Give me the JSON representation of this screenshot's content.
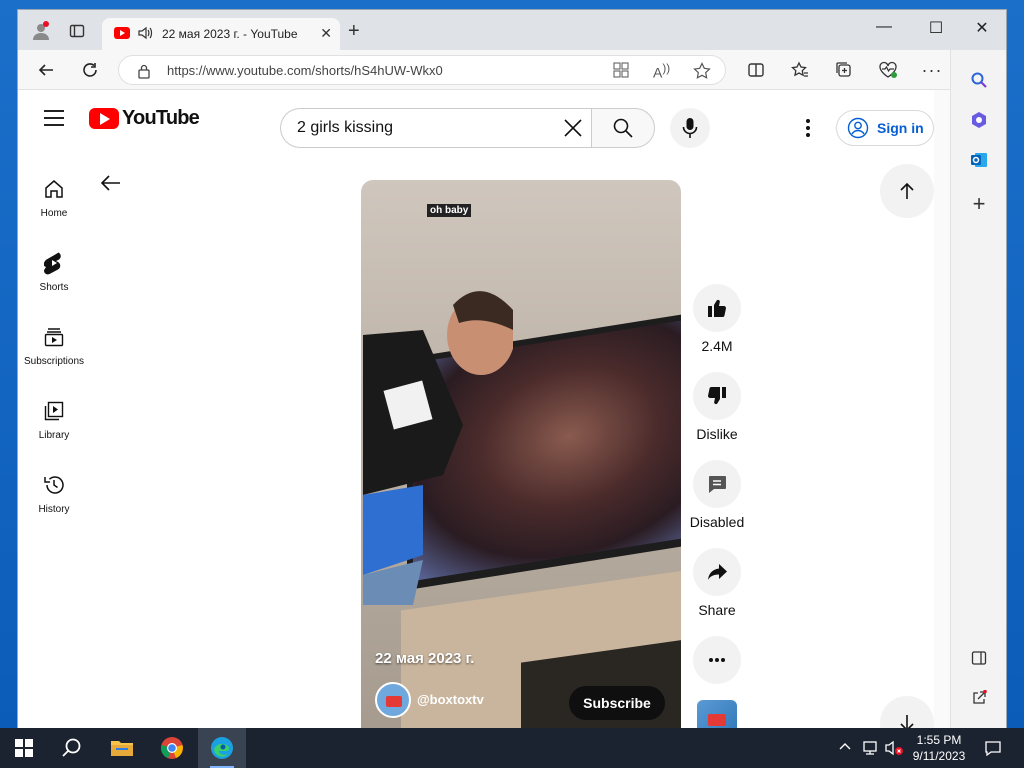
{
  "browser": {
    "tab_title": "22 мая 2023 г. - YouTube",
    "url": "https://www.youtube.com/shorts/hS4hUW-Wkx0",
    "new_tab_glyph": "+",
    "close_glyph": "✕",
    "window_controls": {
      "minimize": "—",
      "maximize": "☐",
      "close": "✕"
    }
  },
  "youtube": {
    "logo_text": "YouTube",
    "search_value": "2 girls kissing",
    "sign_in": "Sign in",
    "guide": [
      {
        "label": "Home",
        "icon": "home-icon"
      },
      {
        "label": "Shorts",
        "icon": "shorts-icon"
      },
      {
        "label": "Subscriptions",
        "icon": "subscriptions-icon"
      },
      {
        "label": "Library",
        "icon": "library-icon"
      },
      {
        "label": "History",
        "icon": "history-icon"
      }
    ]
  },
  "short": {
    "overlay_caption": "oh baby",
    "date": "22 мая 2023 г.",
    "channel": "@boxtoxtv",
    "subscribe": "Subscribe",
    "likes": "2.4M",
    "dislike": "Dislike",
    "comments": "Disabled",
    "share": "Share"
  },
  "taskbar": {
    "time": "1:55 PM",
    "date": "9/11/2023"
  },
  "colors": {
    "youtube_red": "#ff0000",
    "link_blue": "#065fd4",
    "taskbar": "#1c2330"
  }
}
